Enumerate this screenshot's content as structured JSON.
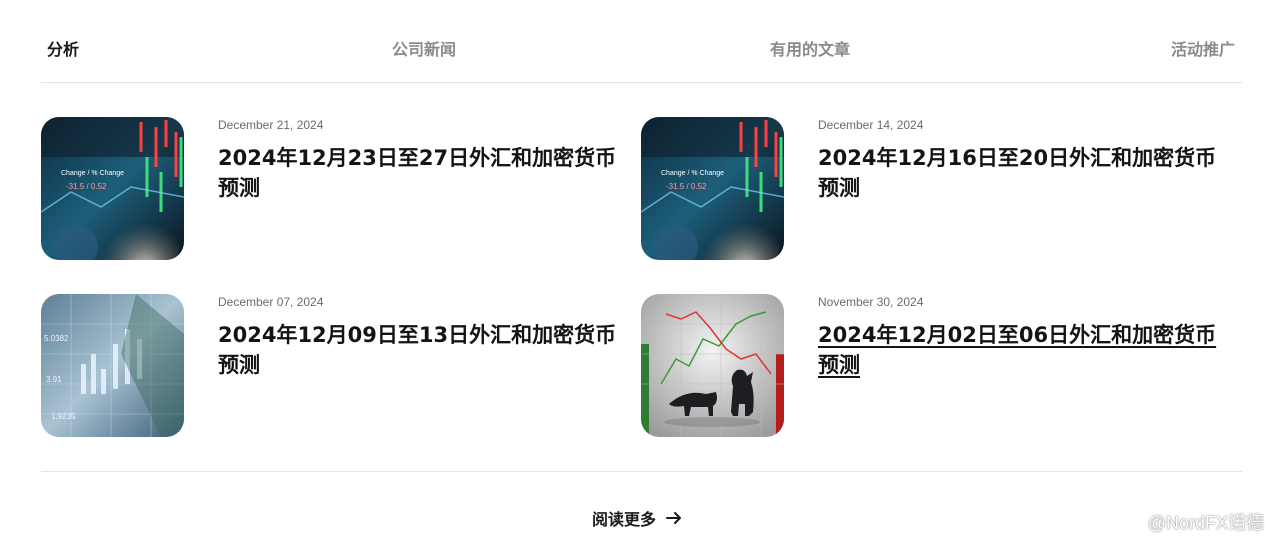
{
  "tabs": [
    {
      "label": "分析",
      "active": true
    },
    {
      "label": "公司新闻",
      "active": false
    },
    {
      "label": "有用的文章",
      "active": false
    },
    {
      "label": "活动推广",
      "active": false
    }
  ],
  "articles": [
    {
      "date": "December 21, 2024",
      "title": "2024年12月23日至27日外汇和加密货币预测",
      "image": "market-screen-coins-image"
    },
    {
      "date": "December 14, 2024",
      "title": "2024年12月16日至20日外汇和加密货币预测",
      "image": "market-screen-coins-image"
    },
    {
      "date": "December 07, 2024",
      "title": "2024年12月09日至13日外汇和加密货币预测",
      "image": "candlestick-dollar-image"
    },
    {
      "date": "November 30, 2024",
      "title": "2024年12月02日至06日外汇和加密货币预测",
      "image": "bull-bear-chart-image"
    }
  ],
  "read_more": {
    "label": "阅读更多",
    "icon": "arrow-right-icon"
  },
  "watermark": {
    "text": "@NordFX诺德",
    "icon": "wechat-logo-icon"
  }
}
